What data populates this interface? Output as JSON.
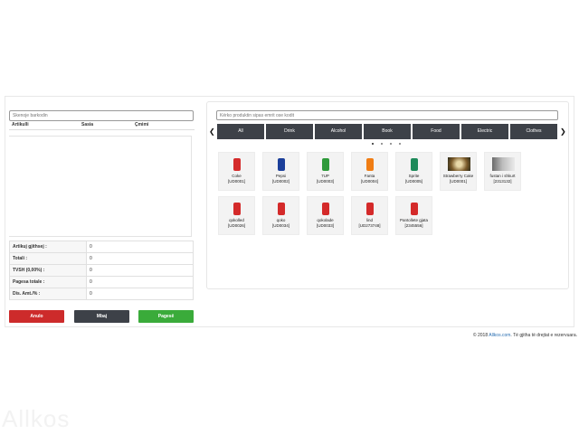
{
  "left_panel": {
    "barcode_placeholder": "Skenoje barkodin",
    "columns": [
      "Artikulli",
      "Sasia",
      "Çmimi"
    ],
    "totals": [
      {
        "label": "Artikuj gjithsej :",
        "value": "0"
      },
      {
        "label": "Totali :",
        "value": "0"
      },
      {
        "label": "TVSH (0,00%) :",
        "value": "0"
      },
      {
        "label": "Pagesa totale :",
        "value": "0"
      },
      {
        "label": "Dis. Amt./% :",
        "value": "0"
      }
    ],
    "buttons": {
      "cancel": "Anulo",
      "hold": "Mbaj",
      "pay": "Pagesë"
    }
  },
  "right_panel": {
    "search_placeholder": "Kërko produktin sipas emrit ose kodit",
    "categories": [
      "All",
      "Drink",
      "Alcohol",
      "Book",
      "Food",
      "Electric",
      "Clothes"
    ],
    "products": [
      {
        "name": "Coke",
        "code": "[UD0001]",
        "color": "#d42a2a"
      },
      {
        "name": "Pepsi",
        "code": "[UD0002]",
        "color": "#1b3f9a"
      },
      {
        "name": "7UP",
        "code": "[UD0003]",
        "color": "#2e9a3a"
      },
      {
        "name": "Fanta",
        "code": "[UD0004]",
        "color": "#f07d14"
      },
      {
        "name": "Sprite",
        "code": "[UD0005]",
        "color": "#1e8a5a"
      },
      {
        "name": "Strawberry Cake",
        "code": "[UD0001]",
        "color": "#7a5a2a"
      },
      {
        "name": "fustan i shkurt",
        "code": "[2313132]",
        "color": "#8a8a8a"
      },
      {
        "name": "qokolled",
        "code": "[UD0026]",
        "color": "#d42a2a"
      },
      {
        "name": "qoko",
        "code": "[UD0034]",
        "color": "#d42a2a"
      },
      {
        "name": "qokolade",
        "code": "[UD0033]",
        "color": "#d42a2a"
      },
      {
        "name": "lind",
        "code": "[UD273748]",
        "color": "#d42a2a"
      },
      {
        "name": "Pantollete gjata",
        "code": "[2345556]",
        "color": "#d42a2a"
      }
    ],
    "pager_dots": 4
  },
  "footer": {
    "prefix": "© 2018",
    "link": "Allkos.com",
    "suffix": "Të gjitha të drejtat e rezervuara."
  },
  "watermark": "Allkos"
}
